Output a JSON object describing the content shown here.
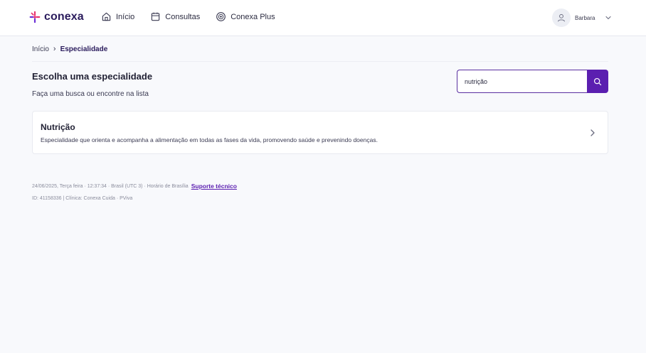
{
  "header": {
    "logo_text": "conexa",
    "nav": [
      {
        "label": "Início",
        "icon": "home-icon"
      },
      {
        "label": "Consultas",
        "icon": "calendar-icon"
      },
      {
        "label": "Conexa Plus",
        "icon": "plus-circle-icon"
      }
    ],
    "user": {
      "name": "Barbara",
      "icon": "user-icon"
    }
  },
  "breadcrumb": {
    "home": "Início",
    "separator": "›",
    "current": "Especialidade"
  },
  "page": {
    "title": "Escolha uma especialidade",
    "subtitle": "Faça uma busca ou encontre na lista"
  },
  "search": {
    "value": "nutrição",
    "icon": "search-icon"
  },
  "results": [
    {
      "title": "Nutrição",
      "description": "Especialidade que orienta e acompanha a alimentação em todas as fases da vida, promovendo saúde e prevenindo doenças."
    }
  ],
  "footer": {
    "info": "24/06/2025, Terça feira · 12:37:34 · Brasil (UTC 3) · Horário de Brasília",
    "support_link": "Suporte técnico",
    "ids": "ID: 41158336 | Clínica: Conexa Cuida · PViva"
  },
  "colors": {
    "brand": "#5b1fb0",
    "brand_dark": "#2a1b5c",
    "logo_accent_pink": "#e8356f",
    "logo_accent_purple": "#6b2fd6",
    "background": "#f8f9fc"
  }
}
